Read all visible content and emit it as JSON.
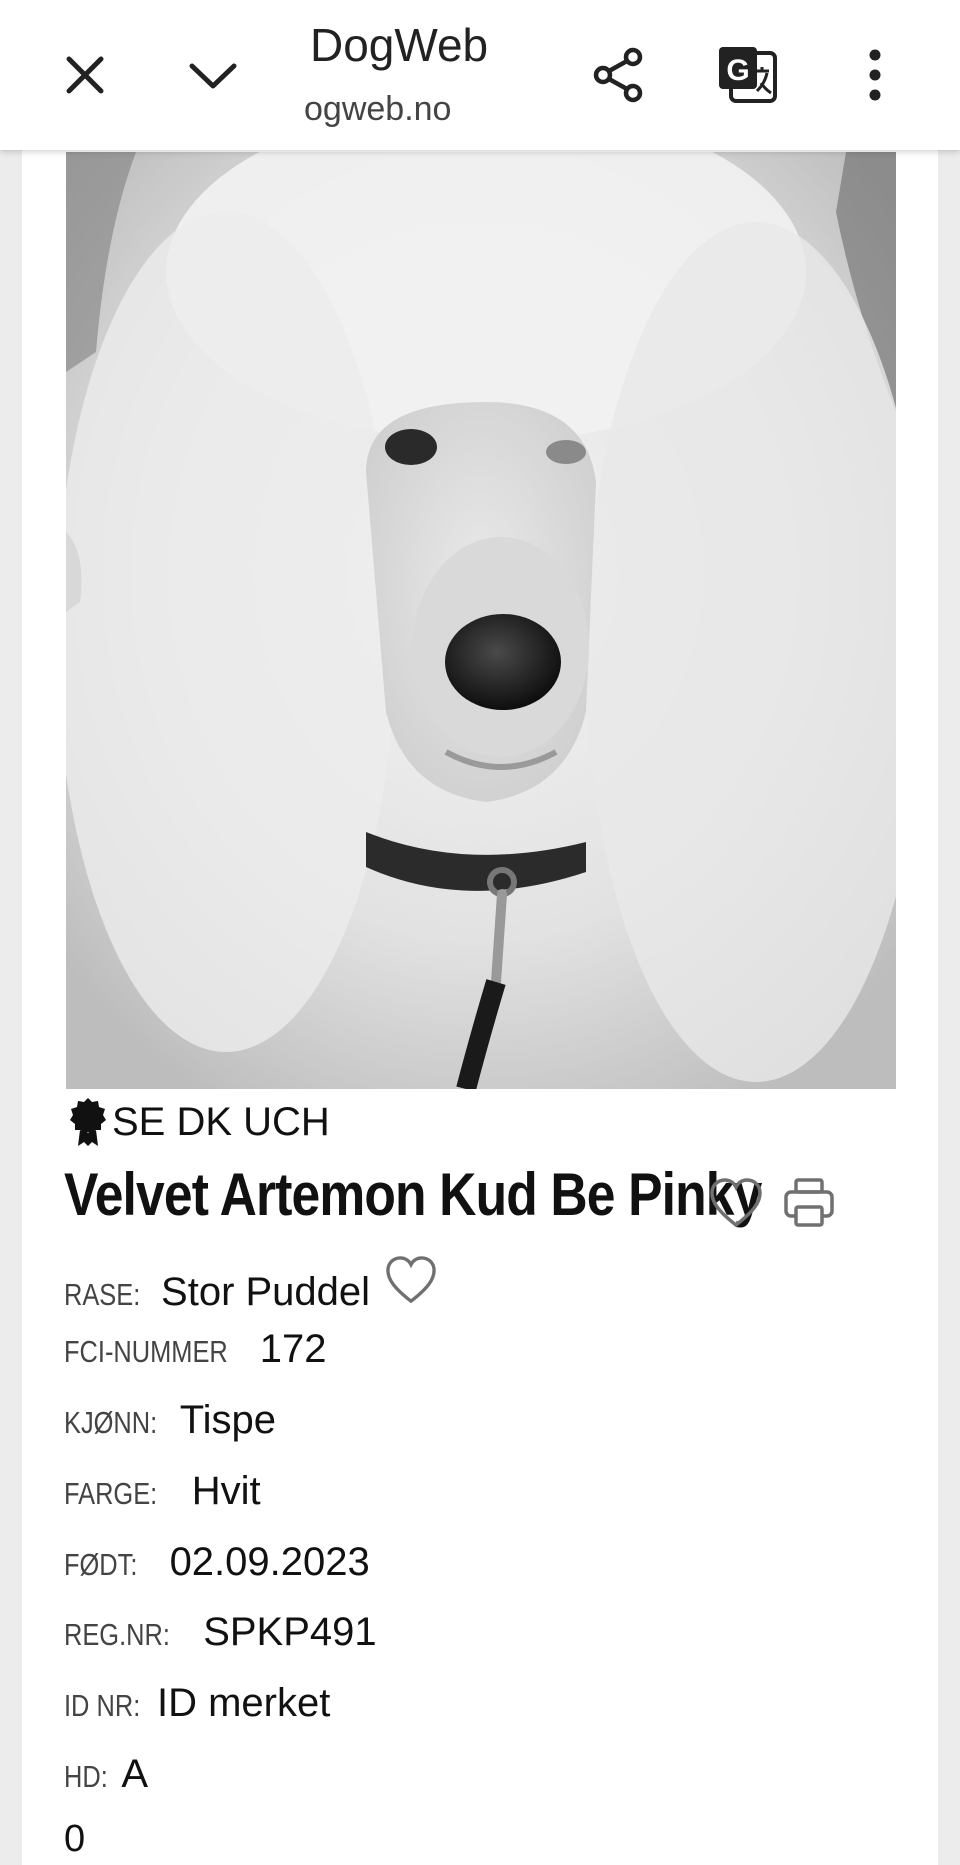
{
  "browser": {
    "site_title": "DogWeb",
    "url": "ogweb.no",
    "icons": [
      "close-icon",
      "chevron-down-icon",
      "share-icon",
      "translate-icon",
      "more-vert-icon"
    ]
  },
  "dog": {
    "title_badge": "SE DK UCH",
    "name": "Velvet Artemon Kud Be Pinky",
    "details": {
      "breed_label": "RASE:",
      "breed": "Stor Puddel",
      "fci_label": "FCI-NUMMER",
      "fci": "172",
      "sex_label": "KJØNN:",
      "sex": "Tispe",
      "color_label": "FARGE:",
      "color": "Hvit",
      "born_label": "FØDT:",
      "born": "02.09.2023",
      "reg_label": "REG.NR:",
      "reg": "SPKP491",
      "id_label": "ID NR:",
      "id": "ID merket",
      "hd_label": "HD:",
      "hd": "A"
    },
    "extra_value": "0"
  },
  "colors": {
    "toolbar_bg": "#ffffff",
    "page_bg": "#ffffff",
    "gutter": "#ececec",
    "icon_gray": "#6f6f6f"
  }
}
